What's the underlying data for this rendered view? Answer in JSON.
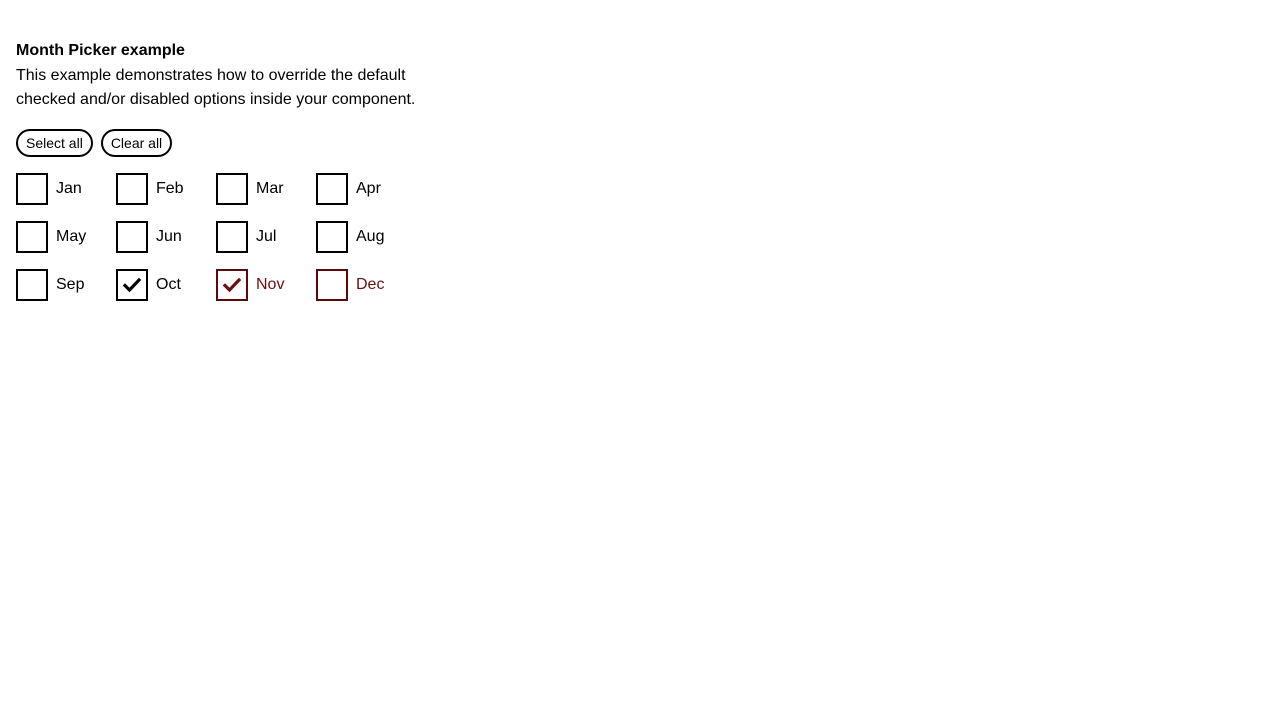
{
  "header": {
    "title": "Month Picker example",
    "description": "This example demonstrates how to override the default checked and/or disabled options inside your component."
  },
  "actions": {
    "select_all_label": "Select all",
    "clear_all_label": "Clear all"
  },
  "colors": {
    "accent": "#6a1010"
  },
  "months": [
    {
      "label": "Jan",
      "checked": false,
      "accent": false
    },
    {
      "label": "Feb",
      "checked": false,
      "accent": false
    },
    {
      "label": "Mar",
      "checked": false,
      "accent": false
    },
    {
      "label": "Apr",
      "checked": false,
      "accent": false
    },
    {
      "label": "May",
      "checked": false,
      "accent": false
    },
    {
      "label": "Jun",
      "checked": false,
      "accent": false
    },
    {
      "label": "Jul",
      "checked": false,
      "accent": false
    },
    {
      "label": "Aug",
      "checked": false,
      "accent": false
    },
    {
      "label": "Sep",
      "checked": false,
      "accent": false
    },
    {
      "label": "Oct",
      "checked": true,
      "accent": false
    },
    {
      "label": "Nov",
      "checked": true,
      "accent": true
    },
    {
      "label": "Dec",
      "checked": false,
      "accent": true
    }
  ]
}
